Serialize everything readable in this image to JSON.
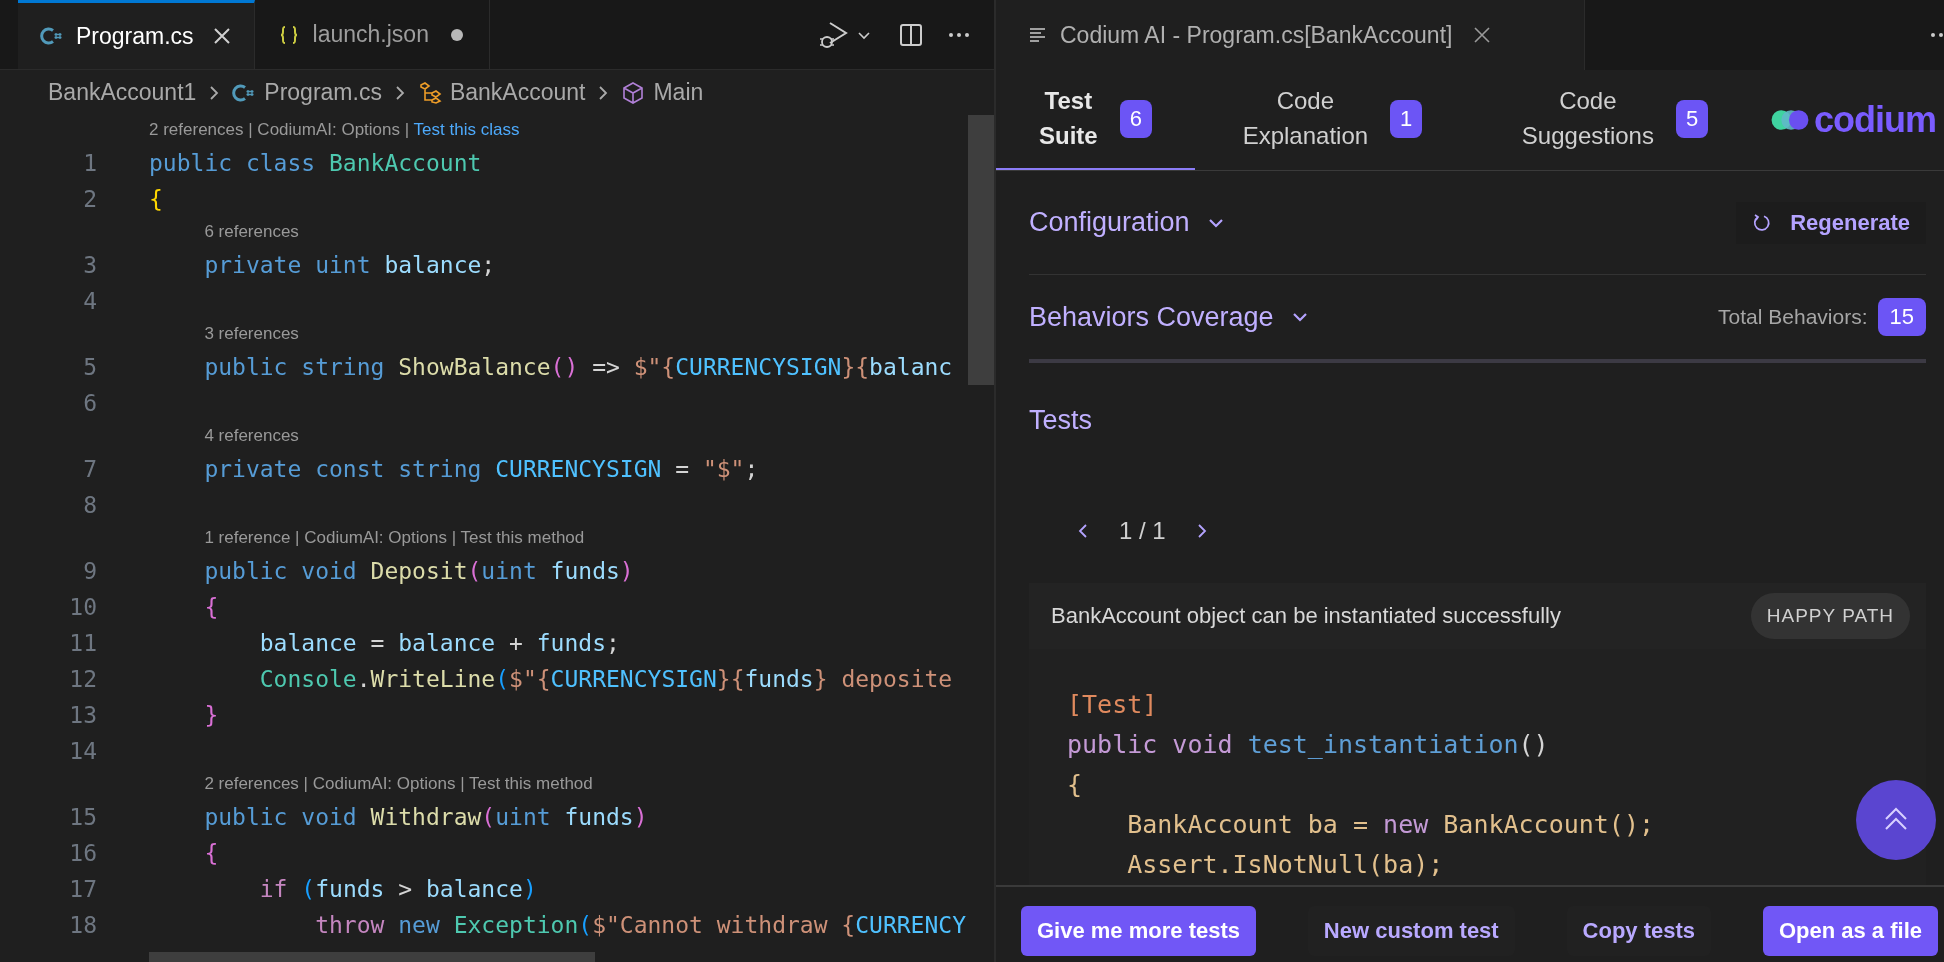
{
  "editor": {
    "tabs": [
      {
        "label": "Program.cs",
        "kind": "csharp",
        "selected": true,
        "modified": false
      },
      {
        "label": "launch.json",
        "kind": "json",
        "selected": false,
        "modified": true
      }
    ],
    "breadcrumbs": [
      {
        "label": "BankAccount1",
        "kind": "folder"
      },
      {
        "label": "Program.cs",
        "kind": "csharp"
      },
      {
        "label": "BankAccount",
        "kind": "class"
      },
      {
        "label": "Main",
        "kind": "method"
      }
    ],
    "lines": [
      {
        "number": "1",
        "lens": {
          "text": "2 references | CodiumAI: Options | ",
          "action": "Test this class",
          "highlighted": true
        },
        "tokens": [
          {
            "kind": "kw",
            "text": "public class "
          },
          {
            "kind": "type",
            "text": "BankAccount"
          }
        ]
      },
      {
        "number": "2",
        "tokens": [
          {
            "kind": "brace1",
            "text": "{"
          }
        ]
      },
      {
        "number": "3",
        "lens": {
          "text": "6 references"
        },
        "tokens": [
          {
            "kind": "kw",
            "text": "    private uint "
          },
          {
            "kind": "var",
            "text": "balance"
          },
          {
            "kind": "plain",
            "text": ";"
          }
        ]
      },
      {
        "number": "4"
      },
      {
        "number": "5",
        "lens": {
          "text": "3 references"
        },
        "tokens": [
          {
            "kind": "kw",
            "text": "    public string "
          },
          {
            "kind": "fn",
            "text": "ShowBalance"
          },
          {
            "kind": "brace2",
            "text": "()"
          },
          {
            "kind": "plain",
            "text": " => "
          },
          {
            "kind": "str",
            "text": "$\"{"
          },
          {
            "kind": "const",
            "text": "CURRENCYSIGN"
          },
          {
            "kind": "str",
            "text": "}{"
          },
          {
            "kind": "var",
            "text": "balanc"
          }
        ]
      },
      {
        "number": "6"
      },
      {
        "number": "7",
        "lens": {
          "text": "4 references"
        },
        "tokens": [
          {
            "kind": "kw",
            "text": "    private const string "
          },
          {
            "kind": "const",
            "text": "CURRENCYSIGN"
          },
          {
            "kind": "plain",
            "text": " = "
          },
          {
            "kind": "str",
            "text": "\"$\""
          },
          {
            "kind": "plain",
            "text": ";"
          }
        ]
      },
      {
        "number": "8"
      },
      {
        "number": "9",
        "lens": {
          "text": "1 reference | CodiumAI: Options | ",
          "action": "Test this method",
          "highlighted": false
        },
        "tokens": [
          {
            "kind": "kw",
            "text": "    public void "
          },
          {
            "kind": "fn",
            "text": "Deposit"
          },
          {
            "kind": "brace2",
            "text": "("
          },
          {
            "kind": "kw",
            "text": "uint "
          },
          {
            "kind": "var",
            "text": "funds"
          },
          {
            "kind": "brace2",
            "text": ")"
          }
        ]
      },
      {
        "number": "10",
        "tokens": [
          {
            "kind": "brace2",
            "text": "    {"
          }
        ]
      },
      {
        "number": "11",
        "tokens": [
          {
            "kind": "var",
            "text": "        balance"
          },
          {
            "kind": "plain",
            "text": " = "
          },
          {
            "kind": "var",
            "text": "balance"
          },
          {
            "kind": "plain",
            "text": " + "
          },
          {
            "kind": "var",
            "text": "funds"
          },
          {
            "kind": "plain",
            "text": ";"
          }
        ]
      },
      {
        "number": "12",
        "tokens": [
          {
            "kind": "type",
            "text": "        Console"
          },
          {
            "kind": "plain",
            "text": "."
          },
          {
            "kind": "fn",
            "text": "WriteLine"
          },
          {
            "kind": "brace3",
            "text": "("
          },
          {
            "kind": "str",
            "text": "$\"{"
          },
          {
            "kind": "const",
            "text": "CURRENCYSIGN"
          },
          {
            "kind": "str",
            "text": "}{"
          },
          {
            "kind": "var",
            "text": "funds"
          },
          {
            "kind": "str",
            "text": "} deposite"
          }
        ]
      },
      {
        "number": "13",
        "tokens": [
          {
            "kind": "brace2",
            "text": "    }"
          }
        ]
      },
      {
        "number": "14"
      },
      {
        "number": "15",
        "lens": {
          "text": "2 references | CodiumAI: Options | ",
          "action": "Test this method",
          "highlighted": false
        },
        "tokens": [
          {
            "kind": "kw",
            "text": "    public void "
          },
          {
            "kind": "fn",
            "text": "Withdraw"
          },
          {
            "kind": "brace2",
            "text": "("
          },
          {
            "kind": "kw",
            "text": "uint "
          },
          {
            "kind": "var",
            "text": "funds"
          },
          {
            "kind": "brace2",
            "text": ")"
          }
        ]
      },
      {
        "number": "16",
        "tokens": [
          {
            "kind": "brace2",
            "text": "    {"
          }
        ]
      },
      {
        "number": "17",
        "tokens": [
          {
            "kind": "ctrl",
            "text": "        if "
          },
          {
            "kind": "brace3",
            "text": "("
          },
          {
            "kind": "var",
            "text": "funds"
          },
          {
            "kind": "plain",
            "text": " > "
          },
          {
            "kind": "var",
            "text": "balance"
          },
          {
            "kind": "brace3",
            "text": ")"
          }
        ]
      },
      {
        "number": "18",
        "tokens": [
          {
            "kind": "ctrl",
            "text": "            throw "
          },
          {
            "kind": "kw",
            "text": "new "
          },
          {
            "kind": "type",
            "text": "Exception"
          },
          {
            "kind": "brace3",
            "text": "("
          },
          {
            "kind": "str",
            "text": "$\"Cannot withdraw {"
          },
          {
            "kind": "const",
            "text": "CURRENCY"
          }
        ]
      }
    ]
  },
  "panel": {
    "title": "Codium AI - Program.cs[BankAccount]",
    "tabs": [
      {
        "label": "Test Suite",
        "count": "6",
        "selected": true
      },
      {
        "label": "Code Explanation",
        "count": "1",
        "selected": false
      },
      {
        "label": "Code Suggestions",
        "count": "5",
        "selected": false
      }
    ],
    "logo": "codium",
    "configuration": {
      "label": "Configuration",
      "expanded": false,
      "action": "Regenerate"
    },
    "coverage": {
      "label": "Behaviors Coverage",
      "expanded": false,
      "total_label": "Total Behaviors:",
      "total": "15"
    },
    "tests": {
      "heading": "Tests",
      "pager": "1 / 1",
      "items": [
        {
          "description": "BankAccount object can be instantiated successfully",
          "tag": "HAPPY PATH",
          "code": [
            [
              {
                "kind": "attr",
                "text": "[Test]"
              }
            ],
            [
              {
                "kind": "kw",
                "text": "public void "
              },
              {
                "kind": "fn",
                "text": "test_instantiation"
              },
              {
                "kind": "punct",
                "text": "()"
              }
            ],
            [
              {
                "kind": "text",
                "text": "{"
              }
            ],
            [
              {
                "kind": "text",
                "text": "    BankAccount ba = "
              },
              {
                "kind": "kw",
                "text": "new "
              },
              {
                "kind": "text",
                "text": "BankAccount();"
              }
            ],
            [
              {
                "kind": "text",
                "text": "    Assert.IsNotNull(ba);"
              }
            ]
          ]
        }
      ]
    },
    "actions": [
      {
        "label": "Give me more tests",
        "primary": true
      },
      {
        "label": "New custom test",
        "primary": false
      },
      {
        "label": "Copy tests",
        "primary": false
      },
      {
        "label": "Open as a file",
        "primary": true
      }
    ]
  }
}
